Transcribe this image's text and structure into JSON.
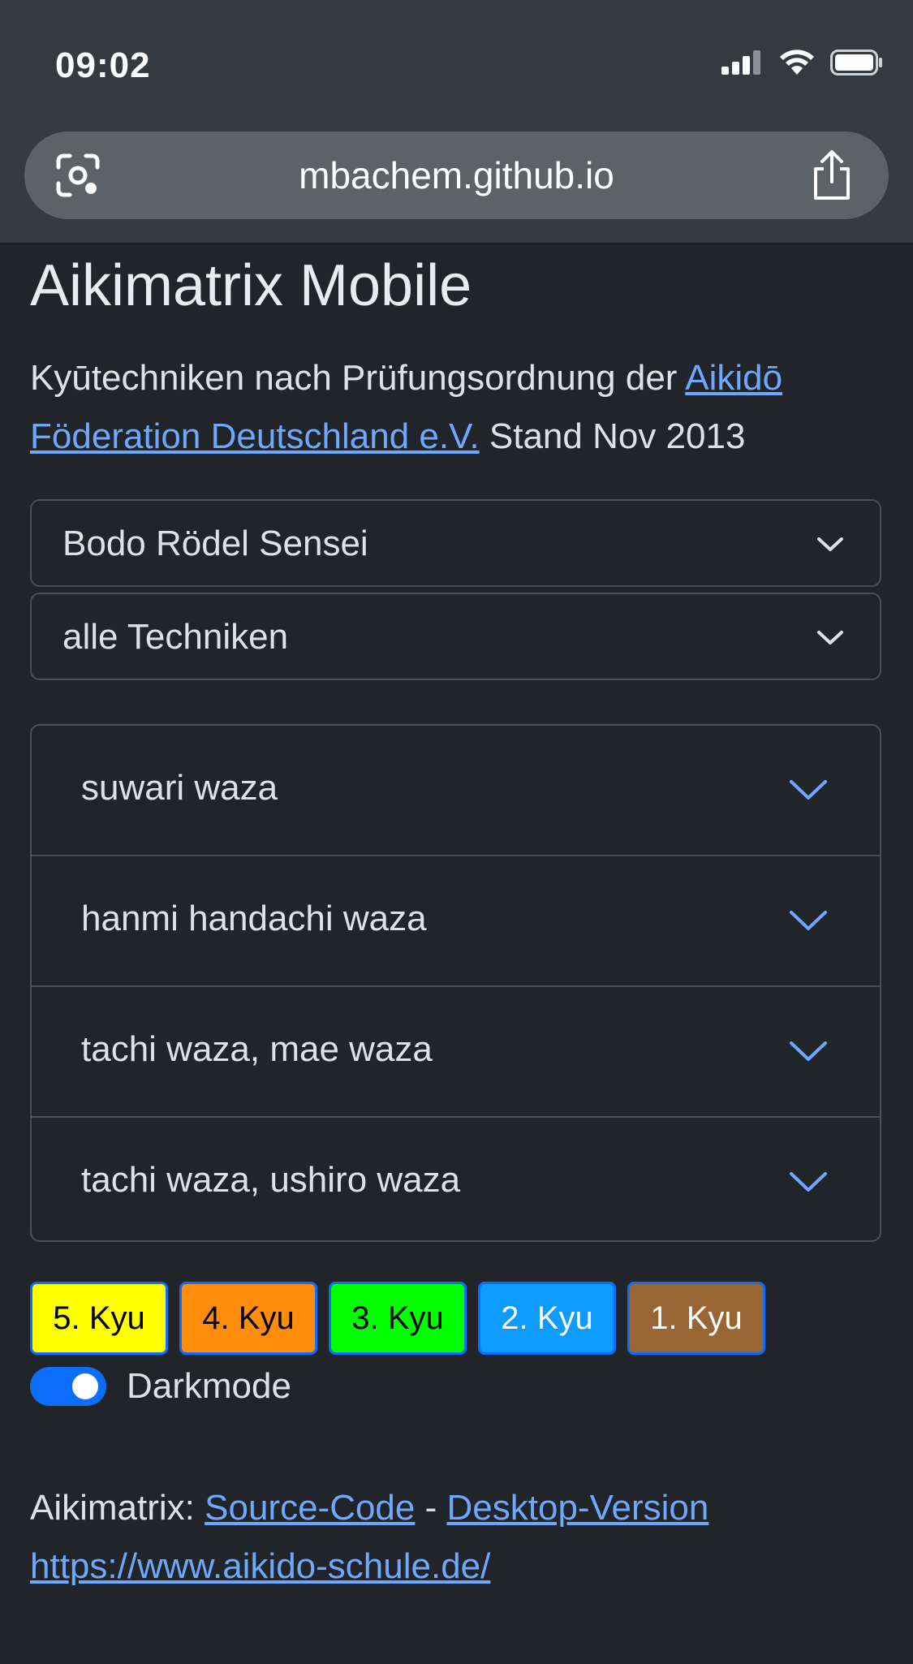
{
  "status_bar": {
    "time": "09:02",
    "icons": [
      "signal-icon",
      "wifi-icon",
      "battery-icon"
    ]
  },
  "browser": {
    "url": "mbachem.github.io",
    "left_icon": "page-capture-icon",
    "right_icon": "share-icon"
  },
  "page": {
    "title": "Aikimatrix Mobile",
    "intro_text": "Kyūtechniken nach Prüfungsordnung der ",
    "intro_link": "Aikidō Föderation Deutschland e.V.",
    "intro_suffix": " Stand Nov 2013"
  },
  "selects": {
    "teacher": "Bodo Rödel Sensei",
    "filter": "alle Techniken"
  },
  "accordion": [
    {
      "label": "suwari waza"
    },
    {
      "label": "hanmi handachi waza"
    },
    {
      "label": "tachi waza, mae waza"
    },
    {
      "label": "tachi waza, ushiro waza"
    }
  ],
  "kyu_buttons": [
    {
      "label": "5. Kyu",
      "bg": "#ffff00",
      "fg": "#000000"
    },
    {
      "label": "4. Kyu",
      "bg": "#ff8c0a",
      "fg": "#000000"
    },
    {
      "label": "3. Kyu",
      "bg": "#00ff00",
      "fg": "#000000"
    },
    {
      "label": "2. Kyu",
      "bg": "#0d9bff",
      "fg": "#ffffff"
    },
    {
      "label": "1. Kyu",
      "bg": "#996633",
      "fg": "#ffffff"
    }
  ],
  "darkmode": {
    "label": "Darkmode",
    "enabled": true
  },
  "footer": {
    "prefix": "Aikimatrix: ",
    "source_link": "Source-Code",
    "separator": " - ",
    "desktop_link": "Desktop-Version",
    "site_link": "https://www.aikido-schule.de/"
  },
  "colors": {
    "background": "#212529",
    "chrome": "#343a40",
    "link": "#6ea8fe",
    "accent": "#0d6efd"
  }
}
